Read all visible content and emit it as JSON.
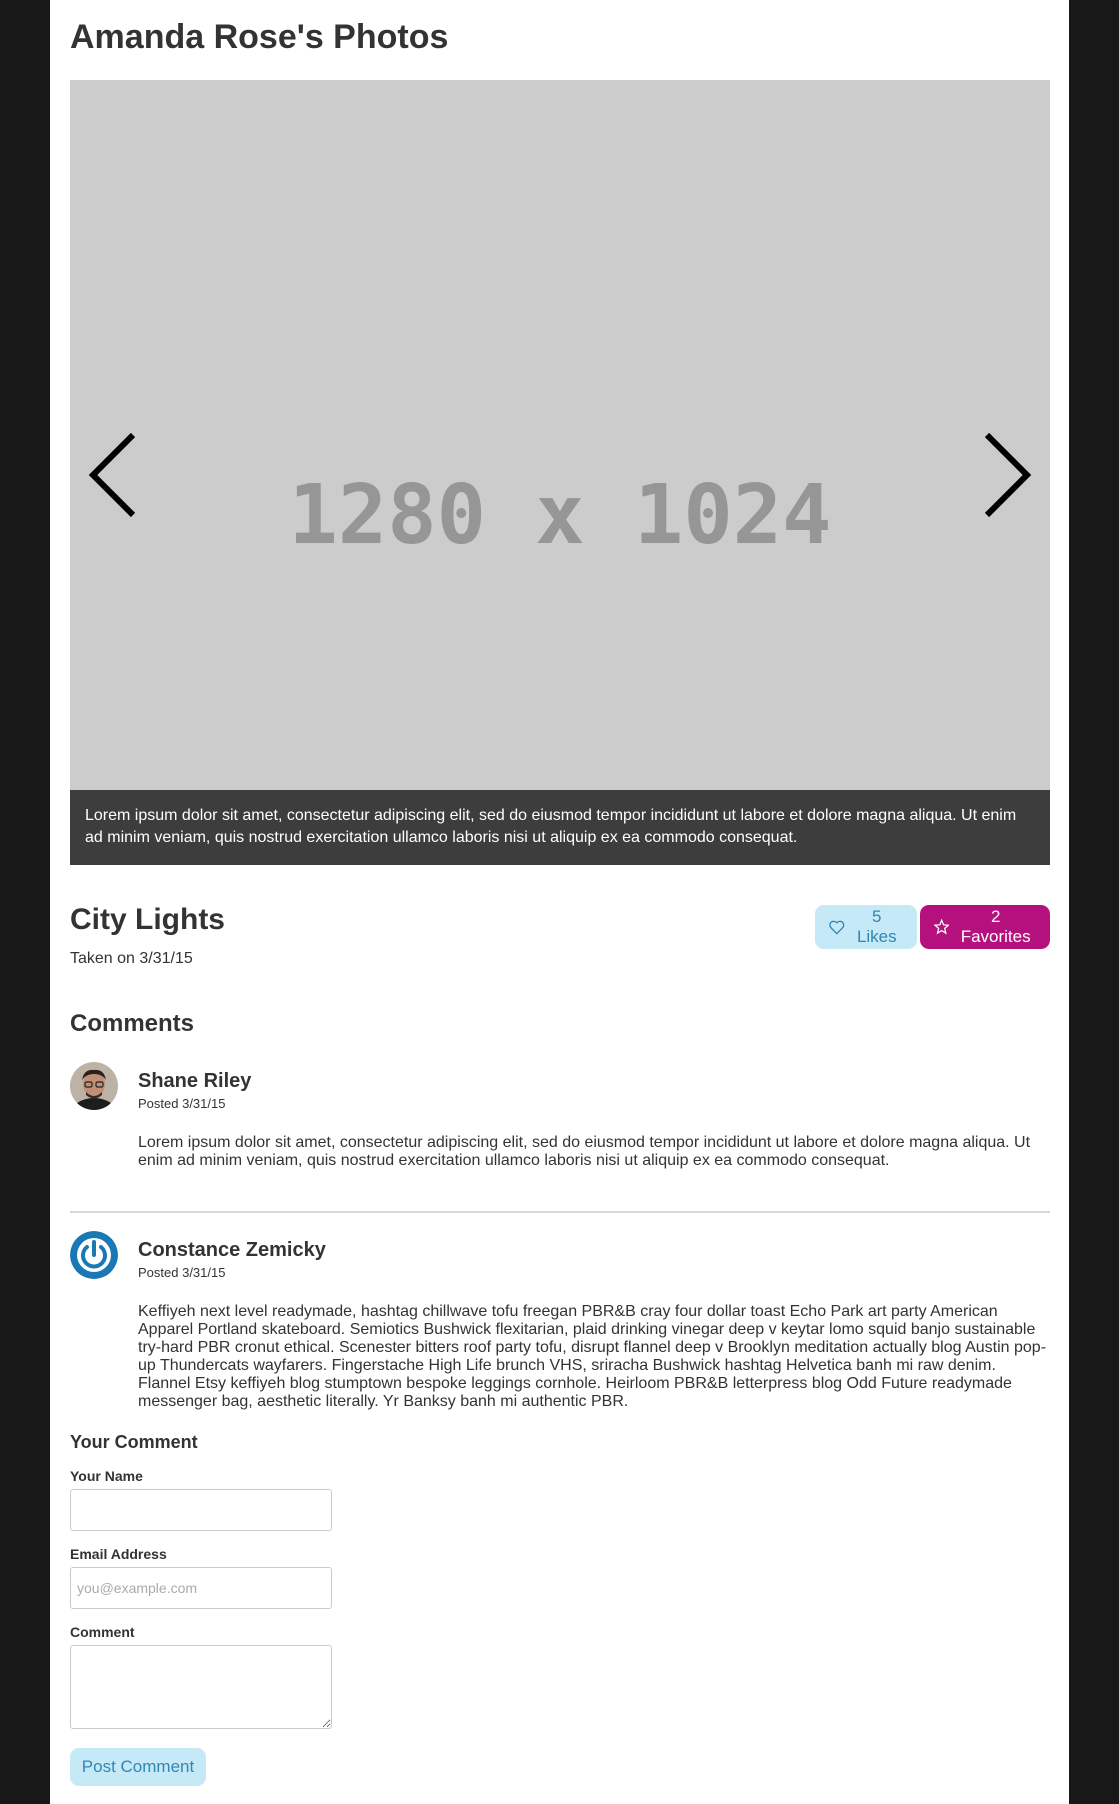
{
  "gallery": {
    "title": "Amanda Rose's Photos"
  },
  "slideshow": {
    "placeholder_text": "1280 x 1024",
    "prev_icon": "chevron-left-icon",
    "next_icon": "chevron-right-icon",
    "caption": "Lorem ipsum dolor sit amet, consectetur adipiscing elit, sed do eiusmod tempor incididunt ut labore et dolore magna aliqua. Ut enim ad minim veniam, quis nostrud exercitation ullamco laboris nisi ut aliquip ex ea commodo consequat."
  },
  "photo": {
    "title": "City Lights",
    "taken": "Taken on 3/31/15",
    "likes_label": "5 Likes",
    "likes_icon": "heart-outline-icon",
    "favorites_label": "2 Favorites",
    "favorites_icon": "star-icon"
  },
  "comments": {
    "heading": "Comments",
    "items": [
      {
        "author": "Shane Riley",
        "posted": "Posted 3/31/15",
        "avatar": "user-photo-avatar",
        "body": "Lorem ipsum dolor sit amet, consectetur adipiscing elit, sed do eiusmod tempor incididunt ut labore et dolore magna aliqua. Ut enim ad minim veniam, quis nostrud exercitation ullamco laboris nisi ut aliquip ex ea commodo consequat."
      },
      {
        "author": "Constance Zemicky",
        "posted": "Posted 3/31/15",
        "avatar": "power-icon-avatar",
        "body": "Keffiyeh next level readymade, hashtag chillwave tofu freegan PBR&B cray four dollar toast Echo Park art party American Apparel Portland skateboard. Semiotics Bushwick flexitarian, plaid drinking vinegar deep v keytar lomo squid banjo sustainable try-hard PBR cronut ethical. Scenester bitters roof party tofu, disrupt flannel deep v Brooklyn meditation actually blog Austin pop-up Thundercats wayfarers. Fingerstache High Life brunch VHS, sriracha Bushwick hashtag Helvetica banh mi raw denim. Flannel Etsy keffiyeh blog stumptown bespoke leggings cornhole. Heirloom PBR&B letterpress blog Odd Future readymade messenger bag, aesthetic literally. Yr Banksy banh mi authentic PBR."
      }
    ]
  },
  "form": {
    "heading": "Your Comment",
    "name_label": "Your Name",
    "name_value": "",
    "email_label": "Email Address",
    "email_placeholder": "you@example.com",
    "comment_label": "Comment",
    "comment_value": "",
    "submit_label": "Post Comment"
  },
  "colors": {
    "background": "#181818",
    "likes_button": "#c6e9f7",
    "likes_text": "#3286b3",
    "favorites_button": "#b5117e",
    "caption_bg": "#3d3d3d",
    "image_placeholder": "#cccccc"
  }
}
